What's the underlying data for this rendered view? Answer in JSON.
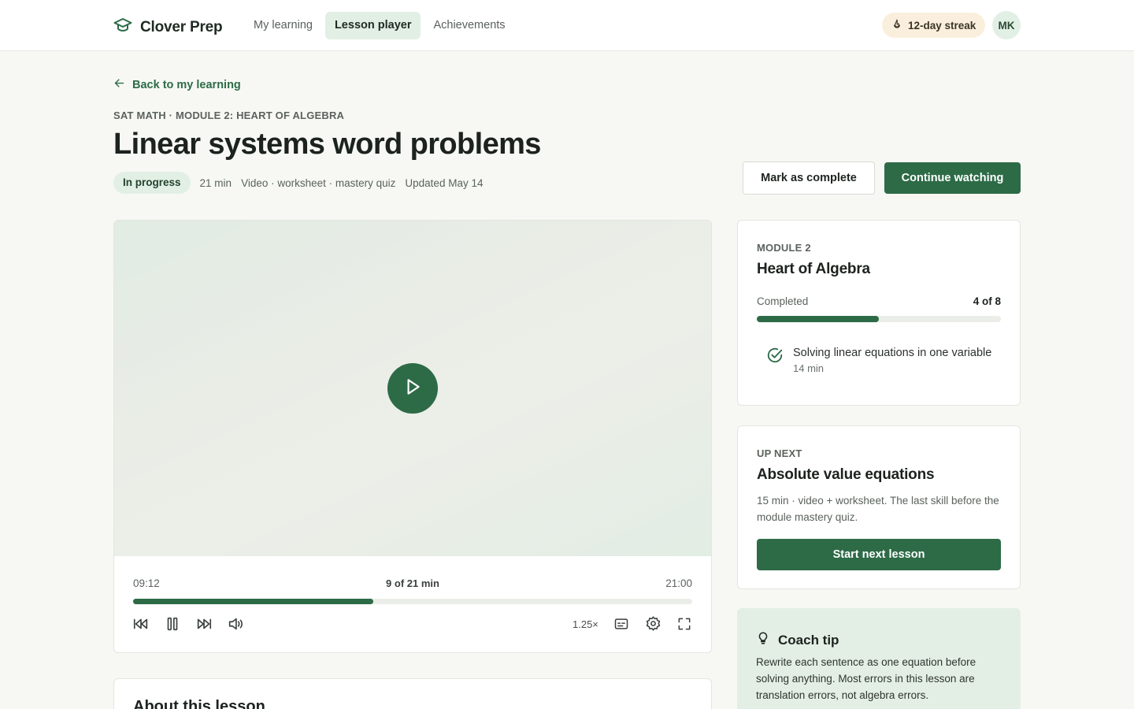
{
  "header": {
    "brand": "Clover Prep",
    "nav": [
      "My learning",
      "Lesson player",
      "Achievements"
    ],
    "active_nav": "Lesson player",
    "streak": "12-day streak",
    "avatar_initials": "MK"
  },
  "lesson": {
    "back_label": "Back to my learning",
    "kicker": "SAT MATH · MODULE 2: HEART OF ALGEBRA",
    "title": "Linear systems word problems",
    "status": "In progress",
    "duration": "21 min",
    "format": "Video · worksheet · mastery quiz",
    "updated": "Updated May 14",
    "mark_complete_label": "Mark as complete",
    "continue_label": "Continue watching"
  },
  "player": {
    "current_time": "09:12",
    "progress_label": "9 of 21 min",
    "total_time": "21:00",
    "progress_fraction": 0.43,
    "speed": "1.25×",
    "icons": [
      "rewind-icon",
      "pause-icon",
      "forward-icon",
      "volume-icon",
      "captions-icon",
      "settings-gear-icon",
      "fullscreen-icon"
    ]
  },
  "about": {
    "title": "About this lesson"
  },
  "module": {
    "kicker": "MODULE 2",
    "title": "Heart of Algebra",
    "completed_label": "Completed",
    "completed_value": "4 of 8",
    "completed_fraction": 0.5,
    "lessons": [
      {
        "name": "Solving linear equations in one variable",
        "duration": "14 min",
        "done": true
      }
    ]
  },
  "up_next": {
    "kicker": "UP NEXT",
    "title": "Absolute value equations",
    "description": "15 min · video + worksheet. The last skill before the module mastery quiz.",
    "button": "Start next lesson"
  },
  "coach_tip": {
    "title": "Coach tip",
    "body": "Rewrite each sentence as one equation before solving anything. Most errors in this lesson are translation errors, not algebra errors."
  },
  "colors": {
    "accent": "#2d6b47",
    "accent_soft": "#e2efe5",
    "streak_bg": "#faefdc",
    "page_bg": "#f7f8f4"
  }
}
